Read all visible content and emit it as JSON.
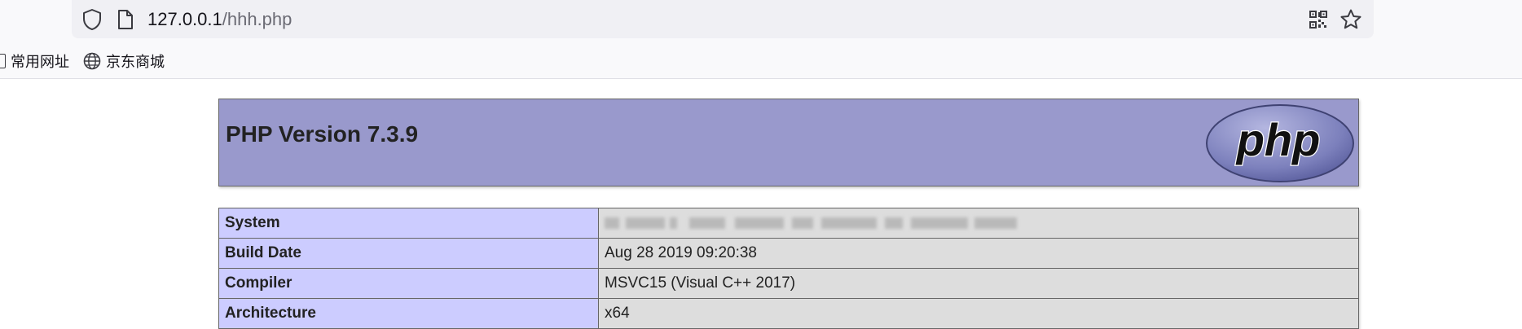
{
  "browser": {
    "url_host": "127.0.0.1",
    "url_path": "/hhh.php",
    "icons": {
      "site_info": "shield-icon",
      "page": "page-icon",
      "qr": "qr-code-icon",
      "bookmark": "star-icon"
    }
  },
  "bookmarks": [
    {
      "label": "常用网址",
      "icon": "folder-icon"
    },
    {
      "label": "京东商城",
      "icon": "globe-icon"
    }
  ],
  "php": {
    "title": "PHP Version 7.3.9",
    "logo_text": "php",
    "rows": [
      {
        "name": "System",
        "value": ""
      },
      {
        "name": "Build Date",
        "value": "Aug 28 2019 09:20:38"
      },
      {
        "name": "Compiler",
        "value": "MSVC15 (Visual C++ 2017)"
      },
      {
        "name": "Architecture",
        "value": "x64"
      }
    ]
  },
  "colors": {
    "header_bg": "#9999cc",
    "label_cell_bg": "#ccccff",
    "value_cell_bg": "#dddddd",
    "border": "#666666"
  }
}
